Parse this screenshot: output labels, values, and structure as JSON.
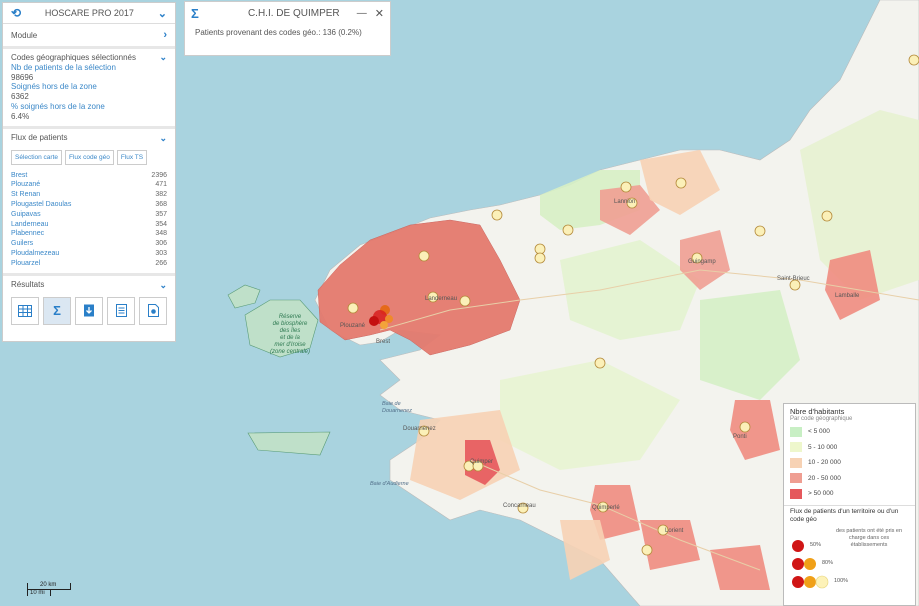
{
  "app": {
    "title": "HOSCARE PRO 2017"
  },
  "module": {
    "label": "Module"
  },
  "geo": {
    "title": "Codes géographiques sélectionnés",
    "nb_label": "Nb de patients de la sélection",
    "nb_value": "98696",
    "hors_label": "Soignés hors de la zone",
    "hors_value": "6362",
    "pct_label": "% soignés hors de la zone",
    "pct_value": "6.4%"
  },
  "flux": {
    "title": "Flux de patients",
    "buttons": [
      "Sélection carte",
      "Flux code géo",
      "Flux TS"
    ],
    "rows": [
      {
        "name": "Brest",
        "value": "2396"
      },
      {
        "name": "Plouzané",
        "value": "471"
      },
      {
        "name": "St Renan",
        "value": "382"
      },
      {
        "name": "Plougastel Daoulas",
        "value": "368"
      },
      {
        "name": "Guipavas",
        "value": "357"
      },
      {
        "name": "Landerneau",
        "value": "354"
      },
      {
        "name": "Plabennec",
        "value": "348"
      },
      {
        "name": "Guilers",
        "value": "306"
      },
      {
        "name": "Ploudalmezeau",
        "value": "303"
      },
      {
        "name": "Plouarzel",
        "value": "266"
      }
    ]
  },
  "results": {
    "title": "Résultats",
    "icons": [
      "table-icon",
      "sigma-icon",
      "download-icon",
      "document-icon",
      "pdf-icon"
    ]
  },
  "popup": {
    "title": "C.H.I. DE QUIMPER",
    "text": "Patients provenant des codes géo.: 136 (0.2%)"
  },
  "map_labels": {
    "reserve": "Réserve de biosphère des îles et de la mer d'Iroise (zone centrale)",
    "baie_douarnenez": "Baie de Douarnenez",
    "baie_audierne": "Baie d'Audierne",
    "lannion": "Lannion",
    "guingamp": "Guingamp",
    "st_brieuc": "Saint-Brieuc",
    "lamballe": "Lamballe",
    "quimper": "Quimper",
    "pontivy": "Ponti",
    "concarneau": "Concarneau",
    "quimperle": "Quimperlé",
    "douarnenez": "Douarnenez",
    "brest": "Brest",
    "plouzane": "Plouzané",
    "landerneau": "Landerneau",
    "lorient": "Lorient"
  },
  "legend": {
    "title": "Nbre d'habitants",
    "subtitle": "Par code géographique",
    "classes": [
      {
        "label": "< 5 000",
        "color": "#c8efc4"
      },
      {
        "label": "5 - 10 000",
        "color": "#eef7cc"
      },
      {
        "label": "10 - 20 000",
        "color": "#f7d2b4"
      },
      {
        "label": "20 - 50 000",
        "color": "#ef9e92"
      },
      {
        "label": "> 50 000",
        "color": "#e5585c"
      }
    ],
    "flux_title": "Flux de patients d'un territoire ou d'un code géo",
    "flux_desc": "des patients ont été pris en charge dans ces établissements",
    "pcts": [
      "50%",
      "80%",
      "100%"
    ]
  },
  "scale": {
    "km": "20 km",
    "mi": "10 mi"
  },
  "colors": {
    "accent": "#2a7fc8",
    "sea": "#a9d3df",
    "land": "#f2f2ec"
  }
}
